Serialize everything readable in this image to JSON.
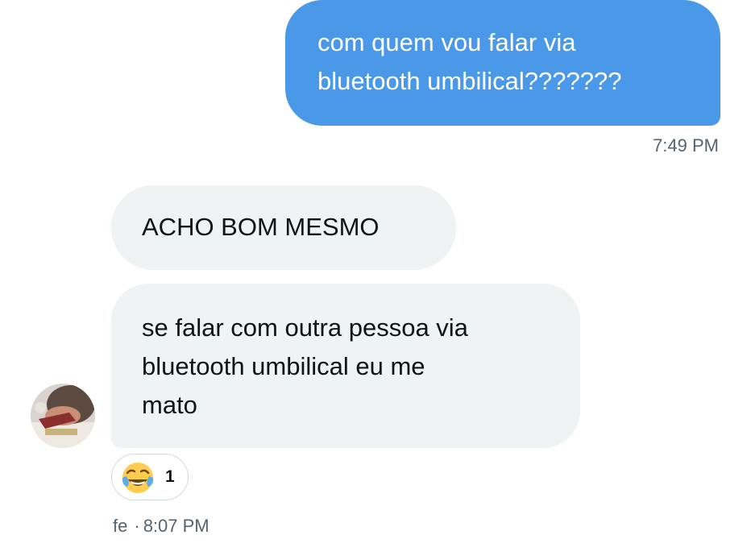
{
  "conversation": {
    "messages": [
      {
        "direction": "outgoing",
        "text": "com quem vou falar via\nbluetooth umbilical???????",
        "time": "7:49 PM"
      },
      {
        "direction": "incoming",
        "text": "ACHO BOM MESMO"
      },
      {
        "direction": "incoming",
        "text": "se falar com outra pessoa via\nbluetooth umbilical eu me\nmato",
        "reaction": {
          "icon": "face-with-tears-of-joy-icon",
          "count": "1"
        },
        "sender": "fe",
        "separator": "·",
        "time": "8:07 PM"
      }
    ]
  },
  "colors": {
    "outgoing_bubble": "#4a99e9",
    "incoming_bubble": "#eff3f4",
    "timestamp": "#536471"
  }
}
